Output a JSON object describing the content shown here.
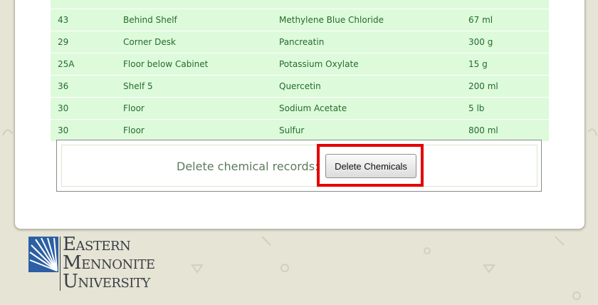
{
  "table": {
    "rows": [
      {
        "room": "43",
        "location": "Behind Shelf",
        "chemical": "Methylene Blue Chloride",
        "amount": "67 ml"
      },
      {
        "room": "29",
        "location": "Corner Desk",
        "chemical": "Pancreatin",
        "amount": "300 g"
      },
      {
        "room": "25A",
        "location": "Floor below Cabinet",
        "chemical": "Potassium Oxylate",
        "amount": "15 g"
      },
      {
        "room": "36",
        "location": "Shelf 5",
        "chemical": "Quercetin",
        "amount": "200 ml"
      },
      {
        "room": "30",
        "location": "Floor",
        "chemical": "Sodium Acetate",
        "amount": "5 lb"
      },
      {
        "room": "30",
        "location": "Floor",
        "chemical": "Sulfur",
        "amount": "800 ml"
      }
    ]
  },
  "delete_section": {
    "label": "Delete chemical records:",
    "button_label": "Delete Chemicals"
  },
  "logo": {
    "line1_cap": "E",
    "line1_rest": "ASTERN",
    "line2_cap": "M",
    "line2_rest": "ENNONITE",
    "line3_cap": "U",
    "line3_rest": "NIVERSITY"
  },
  "colors": {
    "row_background": "#ddfadb",
    "row_text": "#256b2d",
    "highlight": "#e40000",
    "page_background": "#e6e4d4",
    "logo_blue": "#2c5fa3"
  }
}
